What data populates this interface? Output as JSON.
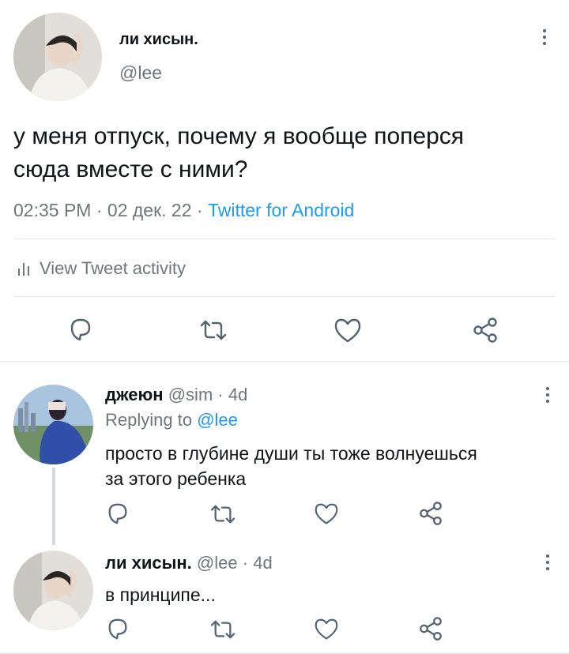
{
  "main_tweet": {
    "author_name": "ли хисын.",
    "handle": "@lee",
    "text_line1": "у меня отпуск, почему я вообще поперся",
    "text_line2": "сюда вместе с ними?",
    "time": "02:35 PM",
    "date": "02 дек. 22",
    "separator": "·",
    "source": "Twitter for Android",
    "activity_label": "View Tweet activity"
  },
  "replies": [
    {
      "author_name": "джеюн",
      "handle": "@sim",
      "age": "4d",
      "replying_to_label": "Replying to",
      "replying_to_handle": "@lee",
      "text_line1": "просто в глубине души ты тоже волнуешься",
      "text_line2": "за этого ребенка"
    },
    {
      "author_name": "ли хисын.",
      "handle": "@lee",
      "age": "4d",
      "text_line1": "в принципе..."
    }
  ],
  "icons": {
    "reply": "reply-icon",
    "retweet": "retweet-icon",
    "like": "like-icon",
    "share": "share-icon",
    "more": "more-vertical-icon",
    "activity": "bar-chart-icon"
  },
  "colors": {
    "link": "#1d9bf0",
    "muted": "#6e767d",
    "icon": "#536471",
    "text": "#0f1419"
  }
}
